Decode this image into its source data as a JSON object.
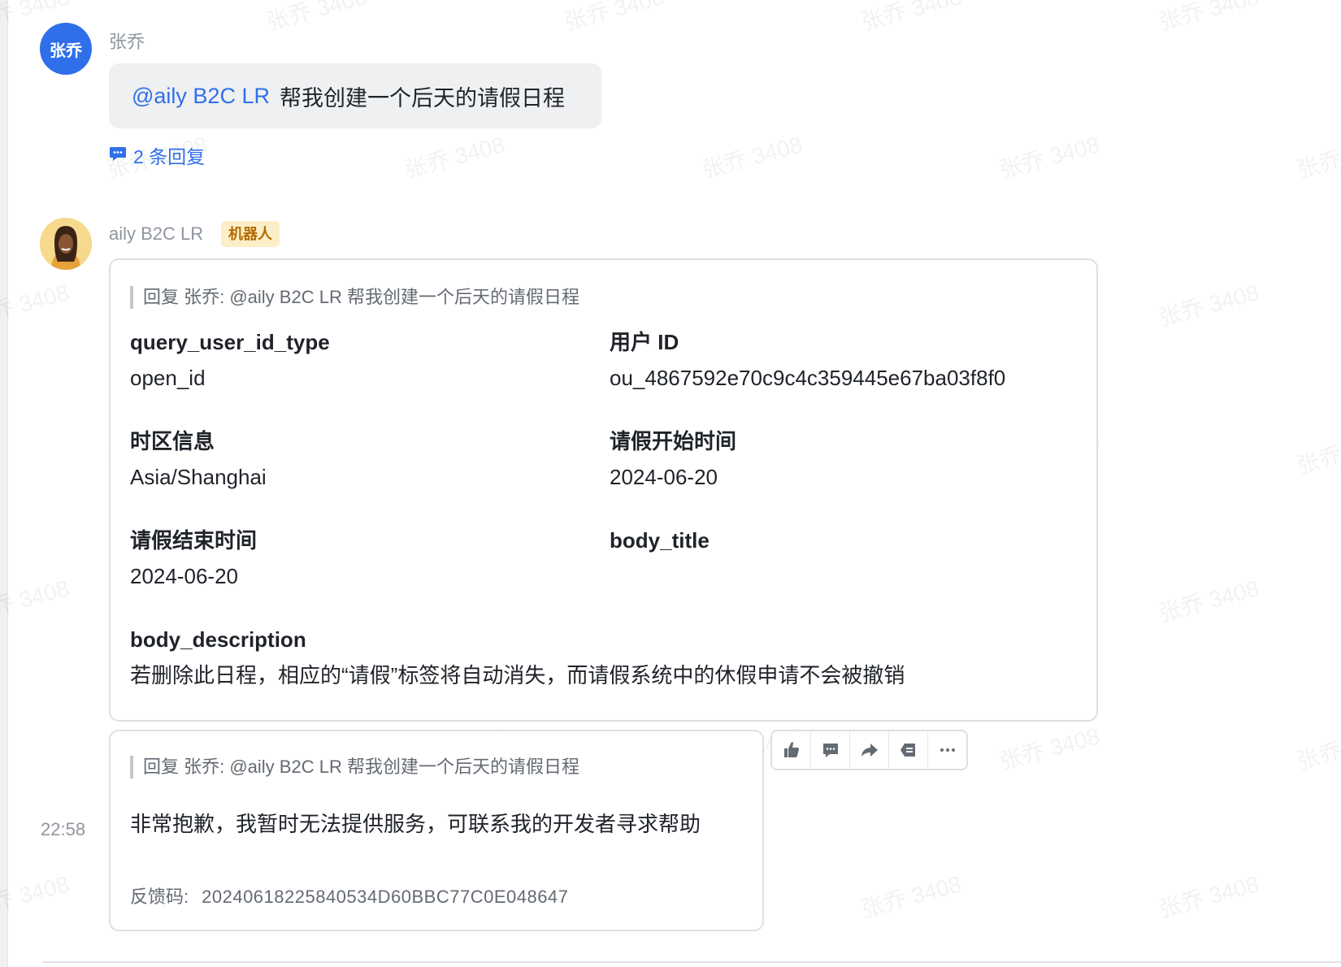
{
  "messages": {
    "user": {
      "avatar_text": "张乔",
      "name": "张乔",
      "mention": "@aily B2C LR",
      "text": "帮我创建一个后天的请假日程",
      "reply_count": "2 条回复"
    },
    "bot": {
      "name": "aily B2C LR",
      "badge": "机器人",
      "card1": {
        "quote": "回复 张乔: @aily B2C LR 帮我创建一个后天的请假日程",
        "fields": [
          {
            "label": "query_user_id_type",
            "value": "open_id"
          },
          {
            "label": "用户 ID",
            "value": "ou_4867592e70c9c4c359445e67ba03f8f0"
          },
          {
            "label": "时区信息",
            "value": "Asia/Shanghai"
          },
          {
            "label": "请假开始时间",
            "value": "2024-06-20"
          },
          {
            "label": "请假结束时间",
            "value": "2024-06-20"
          },
          {
            "label": "body_title",
            "value": ""
          },
          {
            "label": "body_description",
            "value": "若删除此日程，相应的“请假”标签将自动消失，而请假系统中的休假申请不会被撤销"
          }
        ]
      },
      "card2": {
        "quote": "回复 张乔: @aily B2C LR 帮我创建一个后天的请假日程",
        "text": "非常抱歉，我暂时无法提供服务，可联系我的开发者寻求帮助",
        "feedback_label": "反馈码:",
        "feedback_code": "20240618225840534D60BBC77C0E048647"
      },
      "time": "22:58"
    }
  },
  "watermark": "张乔 3408",
  "actions": [
    {
      "icon": "thumbs-up-icon"
    },
    {
      "icon": "reply-comment-icon"
    },
    {
      "icon": "forward-icon"
    },
    {
      "icon": "quote-reply-icon"
    },
    {
      "icon": "more-icon"
    }
  ],
  "colors": {
    "accent": "#2f6fea",
    "bot_badge_bg": "#fcefc7",
    "bot_badge_text": "#b26a00",
    "bubble_bg": "#eff0f1",
    "border": "#dee0e3"
  }
}
